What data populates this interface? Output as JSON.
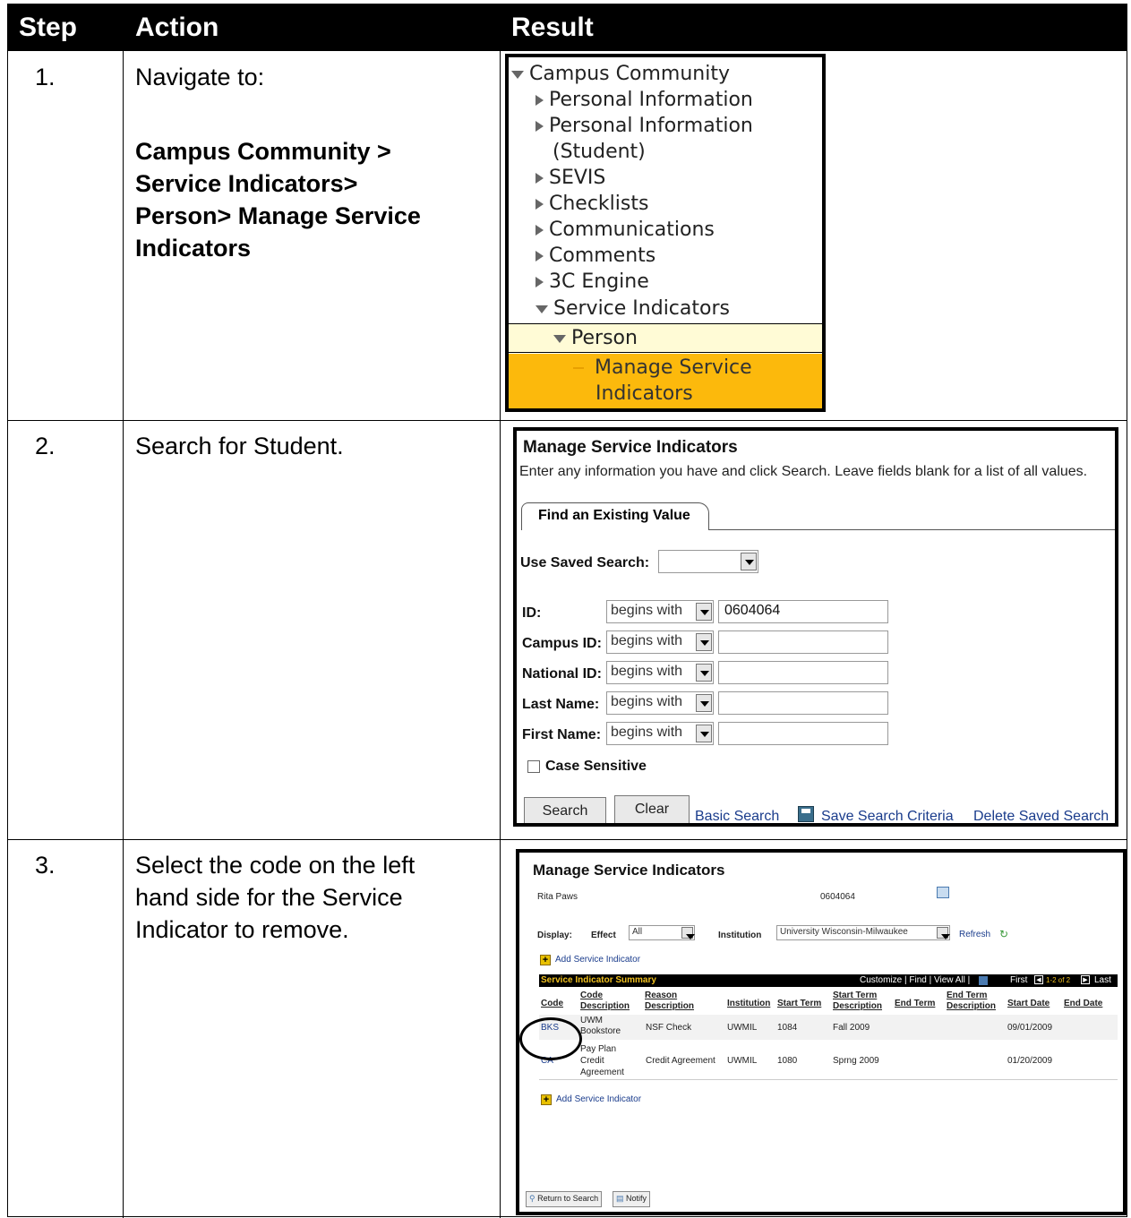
{
  "headers": {
    "step": "Step",
    "action": "Action",
    "result": "Result"
  },
  "rows": [
    {
      "step": "1.",
      "action": "Navigate to:",
      "path_lines": [
        "Campus Community >",
        "Service Indicators>",
        "Person> Manage Service",
        "Indicators"
      ]
    },
    {
      "step": "2.",
      "action": "Search for Student."
    },
    {
      "step": "3.",
      "action_lines": [
        "Select the code on the left",
        "hand side for the Service",
        "Indicator to remove."
      ]
    }
  ],
  "nav": {
    "items": [
      "Campus Community",
      "Personal Information",
      "Personal Information",
      "(Student)",
      "SEVIS",
      "Checklists",
      "Communications",
      "Comments",
      "3C Engine",
      "Service Indicators",
      "Person",
      "Manage Service",
      "Indicators"
    ]
  },
  "search": {
    "title": "Manage Service Indicators",
    "instructions": "Enter any information you have and click Search. Leave fields blank for a list of all values.",
    "tab": "Find an Existing Value",
    "saved_search_label": "Use Saved Search:",
    "fields": [
      {
        "label": "ID:",
        "op": "begins with",
        "value": "0604064"
      },
      {
        "label": "Campus ID:",
        "op": "begins with",
        "value": ""
      },
      {
        "label": "National ID:",
        "op": "begins with",
        "value": ""
      },
      {
        "label": "Last Name:",
        "op": "begins with",
        "value": ""
      },
      {
        "label": "First Name:",
        "op": "begins with",
        "value": ""
      }
    ],
    "case_sensitive": "Case Sensitive",
    "search_btn": "Search",
    "clear_btn": "Clear",
    "basic_search": "Basic Search",
    "save_criteria": "Save Search Criteria",
    "delete_saved": "Delete Saved Search"
  },
  "result": {
    "title": "Manage Service Indicators",
    "name": "Rita Paws",
    "id": "0604064",
    "display_label": "Display:",
    "effect_label": "Effect",
    "effect_value": "All",
    "institution_label": "Institution",
    "institution_value": "University Wisconsin-Milwaukee",
    "refresh": "Refresh",
    "add_link": "Add Service Indicator",
    "summary_title": "Service Indicator Summary",
    "summary_tools": "Customize | Find | View All |",
    "nav_first": "First",
    "nav_range": "1-2 of 2",
    "nav_last": "Last",
    "columns": [
      "Code",
      "Code Description",
      "Reason Description",
      "Institution",
      "Start Term",
      "Start Term Description",
      "End Term",
      "End Term Description",
      "Start Date",
      "End Date"
    ],
    "records": [
      {
        "code": "BKS",
        "desc": "UWM Bookstore",
        "reason": "NSF Check",
        "inst": "UWMIL",
        "start_term": "1084",
        "start_desc": "Fall 2009",
        "start_date": "09/01/2009"
      },
      {
        "code": "CA",
        "desc": "Pay Plan Credit Agreement",
        "reason": "Credit Agreement",
        "inst": "UWMIL",
        "start_term": "1080",
        "start_desc": "Sprng 2009",
        "start_date": "01/20/2009"
      }
    ],
    "return_btn": "Return to Search",
    "notify_btn": "Notify"
  }
}
